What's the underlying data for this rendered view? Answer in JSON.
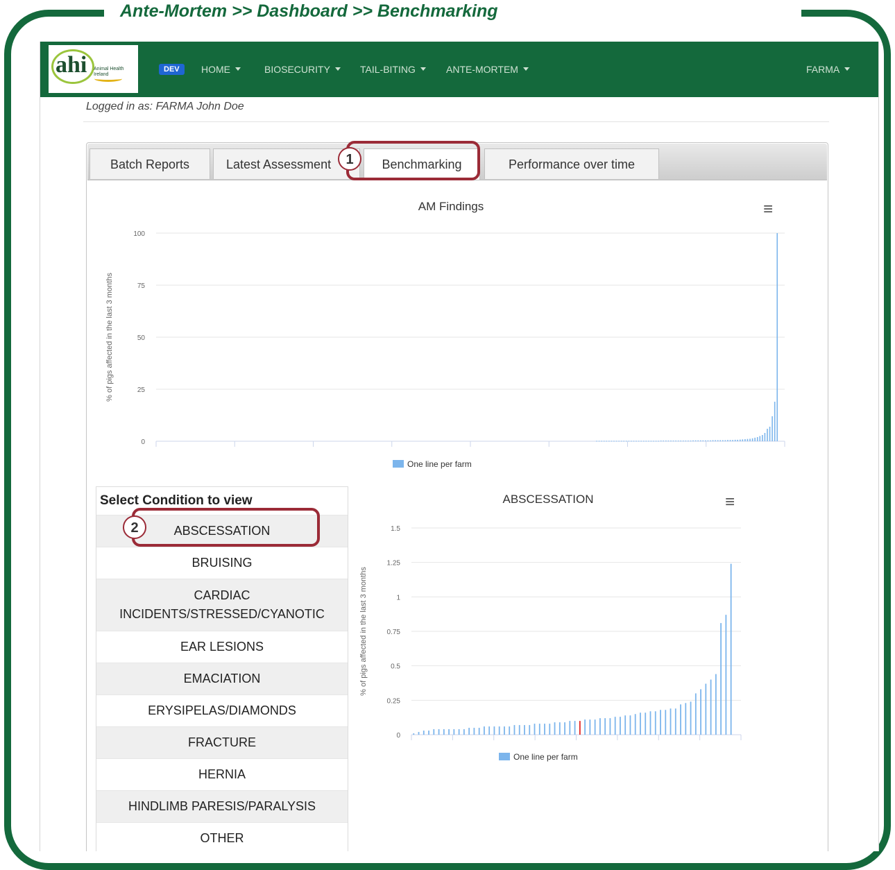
{
  "breadcrumb": "Ante-Mortem >> Dashboard >> Benchmarking",
  "navbar": {
    "logo_text": "ahi",
    "logo_small": "Animal Health Ireland",
    "dev_badge": "DEV",
    "items": [
      "HOME",
      "BIOSECURITY",
      "TAIL-BITING",
      "ANTE-MORTEM"
    ],
    "user_menu": "FARMA"
  },
  "logged_in": "Logged in as: FARMA John Doe",
  "tabs": [
    {
      "label": "Batch Reports",
      "active": false
    },
    {
      "label": "Latest Assessment",
      "active": false
    },
    {
      "label": "Benchmarking",
      "active": true
    },
    {
      "label": "Performance over time",
      "active": false
    }
  ],
  "callouts": [
    "1",
    "2"
  ],
  "menu_glyph": "≡",
  "conditions": {
    "heading": "Select Condition to view",
    "items": [
      "ABSCESSATION",
      "BRUISING",
      "CARDIAC INCIDENTS/STRESSED/CYANOTIC",
      "EAR LESIONS",
      "EMACIATION",
      "ERYSIPELAS/DIAMONDS",
      "FRACTURE",
      "HERNIA",
      "HINDLIMB PARESIS/PARALYSIS",
      "OTHER"
    ]
  },
  "chart_data": [
    {
      "type": "bar",
      "title": "AM Findings",
      "ylabel": "% of pigs affected in the last 3 months",
      "xlabel": "",
      "ylim": [
        0,
        100
      ],
      "yticks": [
        0,
        25,
        50,
        75,
        100
      ],
      "legend": "One line per farm",
      "legend_position": "bottom",
      "grid": true,
      "bar_color": "#7cb5ec",
      "series": [
        {
          "name": "One line per farm",
          "values": [
            0.2,
            0.2,
            0.2,
            0.2,
            0.2,
            0.2,
            0.2,
            0.2,
            0.2,
            0.2,
            0.2,
            0.2,
            0.2,
            0.2,
            0.2,
            0.2,
            0.2,
            0.2,
            0.2,
            0.2,
            0.2,
            0.2,
            0.2,
            0.2,
            0.2,
            0.2,
            0.3,
            0.3,
            0.3,
            0.3,
            0.3,
            0.3,
            0.3,
            0.3,
            0.3,
            0.3,
            0.3,
            0.3,
            0.3,
            0.4,
            0.4,
            0.4,
            0.4,
            0.4,
            0.4,
            0.4,
            0.4,
            0.5,
            0.5,
            0.5,
            0.5,
            0.5,
            0.5,
            0.6,
            0.6,
            0.6,
            0.7,
            0.7,
            0.8,
            0.9,
            1,
            1.1,
            1.2,
            1.4,
            1.7,
            2,
            2.5,
            3,
            4,
            6,
            7,
            12,
            19,
            100
          ]
        }
      ]
    },
    {
      "type": "bar",
      "title": "ABSCESSATION",
      "ylabel": "% of pigs affected in the last 3 months",
      "xlabel": "",
      "ylim": [
        0,
        1.5
      ],
      "yticks": [
        0,
        0.25,
        0.5,
        0.75,
        1,
        1.25,
        1.5
      ],
      "legend": "One line per farm",
      "legend_position": "bottom",
      "grid": true,
      "bar_color": "#7cb5ec",
      "highlight_color": "#e02424",
      "highlight_index": 33,
      "series": [
        {
          "name": "One line per farm",
          "values": [
            0.01,
            0.02,
            0.03,
            0.03,
            0.04,
            0.04,
            0.04,
            0.04,
            0.04,
            0.04,
            0.04,
            0.05,
            0.05,
            0.05,
            0.06,
            0.06,
            0.06,
            0.06,
            0.06,
            0.06,
            0.07,
            0.07,
            0.07,
            0.07,
            0.08,
            0.08,
            0.08,
            0.08,
            0.09,
            0.09,
            0.09,
            0.1,
            0.1,
            0.1,
            0.11,
            0.11,
            0.11,
            0.12,
            0.12,
            0.12,
            0.13,
            0.13,
            0.14,
            0.14,
            0.15,
            0.16,
            0.16,
            0.17,
            0.17,
            0.18,
            0.18,
            0.19,
            0.19,
            0.22,
            0.23,
            0.24,
            0.3,
            0.33,
            0.37,
            0.4,
            0.44,
            0.81,
            0.87,
            1.24
          ]
        }
      ]
    }
  ]
}
